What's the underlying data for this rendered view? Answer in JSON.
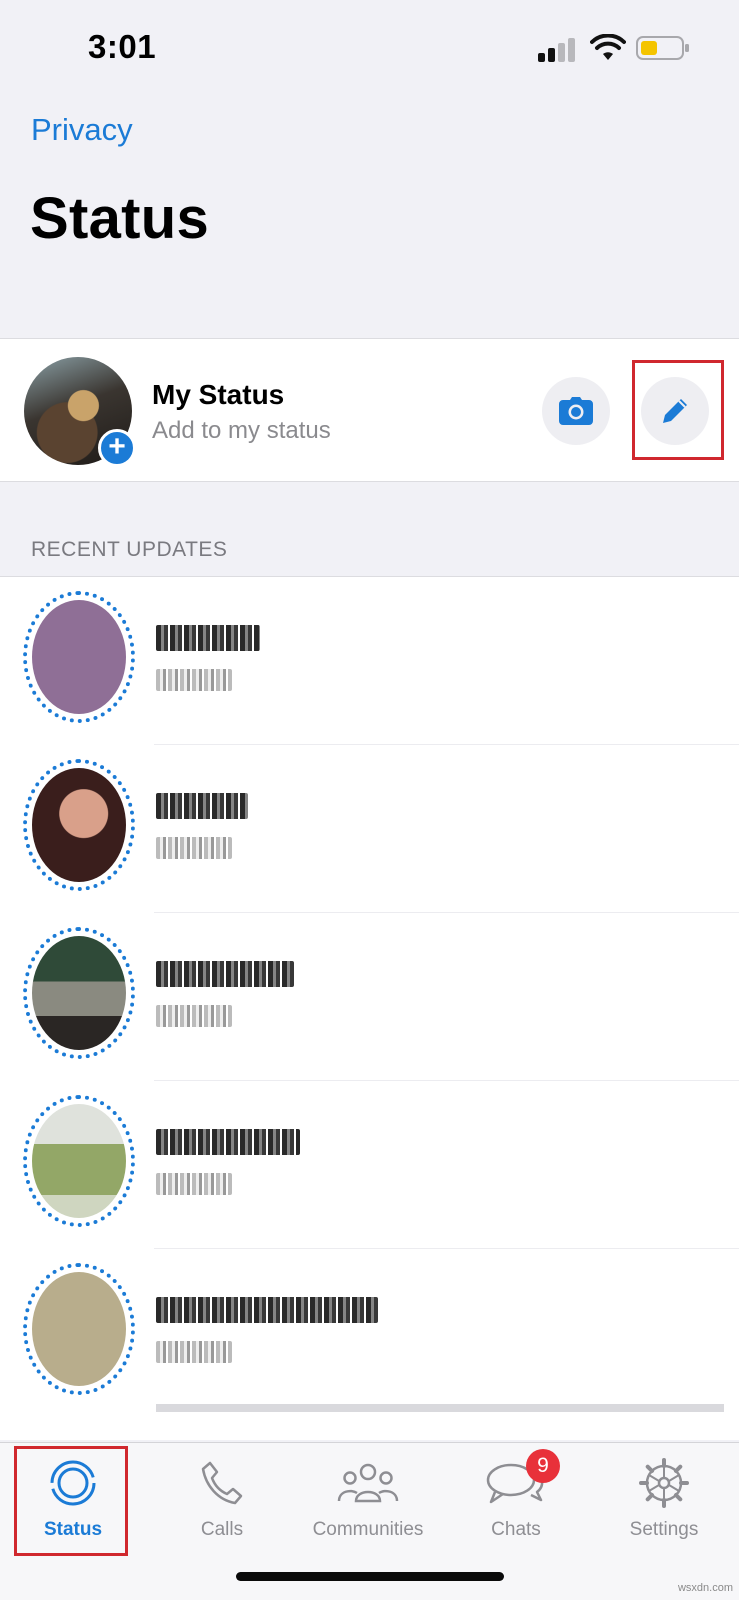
{
  "status_bar": {
    "time": "3:01"
  },
  "header": {
    "back_label": "Privacy",
    "title": "Status"
  },
  "my_status": {
    "name": "My Status",
    "subtitle": "Add to my status",
    "add_icon": "plus-icon",
    "camera_icon": "camera-icon",
    "pencil_icon": "pencil-icon"
  },
  "recent": {
    "section_title": "RECENT UPDATES",
    "rows": [
      {
        "avatar_color": "#8f6f96"
      },
      {
        "avatar_color": "#4a2a2a"
      },
      {
        "avatar_color": "#3c5a44"
      },
      {
        "avatar_color": "#9fb07a"
      },
      {
        "avatar_color": "#b8ad8c"
      }
    ]
  },
  "tabs": [
    {
      "label": "Status",
      "icon": "status-icon",
      "active": true
    },
    {
      "label": "Calls",
      "icon": "phone-icon"
    },
    {
      "label": "Communities",
      "icon": "communities-icon"
    },
    {
      "label": "Chats",
      "icon": "chats-icon",
      "badge": "9"
    },
    {
      "label": "Settings",
      "icon": "gear-icon"
    }
  ],
  "watermark": "wsxdn.com",
  "colors": {
    "accent": "#1b7bd6",
    "highlight_box": "#d0282e",
    "badge": "#e8313a"
  }
}
